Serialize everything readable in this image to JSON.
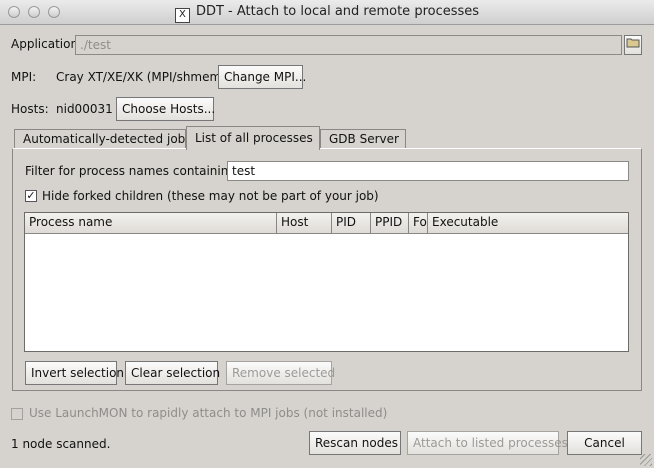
{
  "window": {
    "title": "DDT - Attach to local and remote processes"
  },
  "application": {
    "label": "Application:",
    "value": "./test"
  },
  "mpi": {
    "label": "MPI:",
    "value": "Cray XT/XE/XK (MPI/shmem)",
    "button": "Change MPI..."
  },
  "hosts": {
    "label": "Hosts:",
    "value": "nid00031",
    "button": "Choose Hosts..."
  },
  "tabs": [
    {
      "label": "Automatically-detected jobs",
      "active": false
    },
    {
      "label": "List of all processes",
      "active": true
    },
    {
      "label": "GDB Server",
      "active": false
    }
  ],
  "filter": {
    "label": "Filter for process names containing:",
    "value": "test"
  },
  "hide_forked": {
    "label": "Hide forked children (these may not be part of your job)",
    "checked": true
  },
  "table": {
    "columns": [
      "Process name",
      "Host",
      "PID",
      "PPID",
      "Fo",
      "Executable"
    ],
    "rows": []
  },
  "panel_buttons": {
    "invert": "Invert selection",
    "clear": "Clear selection",
    "remove": "Remove selected"
  },
  "launchmon": {
    "label": "Use LaunchMON to rapidly attach to MPI jobs (not installed)",
    "checked": false
  },
  "status": "1 node scanned.",
  "footer": {
    "rescan": "Rescan nodes",
    "attach": "Attach to listed processes",
    "cancel": "Cancel"
  }
}
